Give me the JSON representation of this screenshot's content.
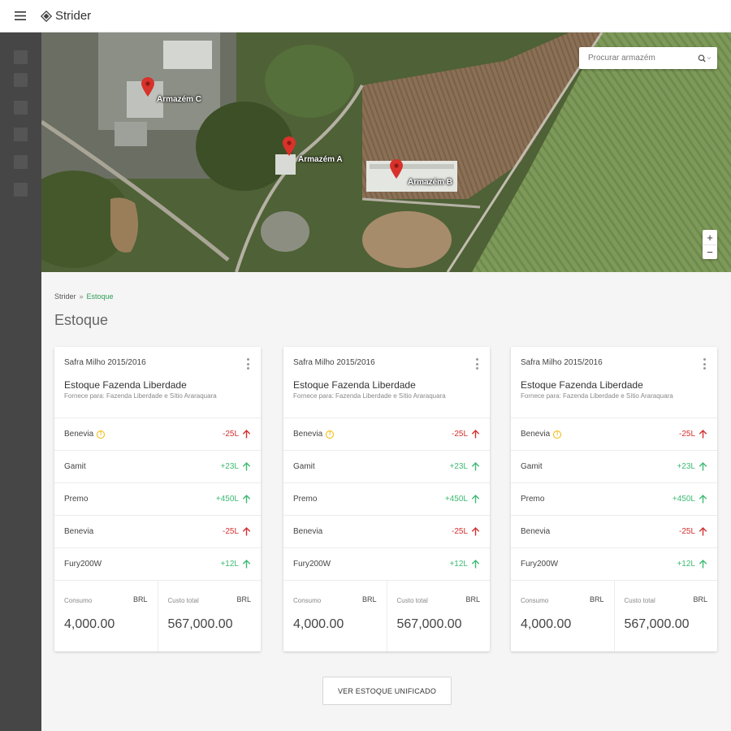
{
  "app": {
    "name": "Strider"
  },
  "sidebar": {
    "items": [
      "",
      "",
      "",
      "",
      "",
      ""
    ]
  },
  "map": {
    "search_placeholder": "Procurar armazém",
    "zoom_in": "+",
    "zoom_out": "−",
    "markers": [
      {
        "label": "Armazém C"
      },
      {
        "label": "Armazém A"
      },
      {
        "label": "Armazém B"
      }
    ]
  },
  "breadcrumb": {
    "root": "Strider",
    "separator": "»",
    "current": "Estoque"
  },
  "page_title": "Estoque",
  "cards": [
    {
      "season": "Safra Milho 2015/2016",
      "title": "Estoque Fazenda Liberdade",
      "subtitle": "Fornece para: Fazenda Liberdade e Sítio Araraquara",
      "rows": [
        {
          "name": "Benevia",
          "warning": true,
          "value": "-25L",
          "trend": "negative"
        },
        {
          "name": "Gamit",
          "warning": false,
          "value": "+23L",
          "trend": "positive"
        },
        {
          "name": "Premo",
          "warning": false,
          "value": "+450L",
          "trend": "positive"
        },
        {
          "name": "Benevia",
          "warning": false,
          "value": "-25L",
          "trend": "negative"
        },
        {
          "name": "Fury200W",
          "warning": false,
          "value": "+12L",
          "trend": "positive"
        }
      ],
      "consumo_label": "Consumo",
      "consumo_currency": "BRL",
      "consumo_value": "4,000.00",
      "custo_label": "Custo total",
      "custo_currency": "BRL",
      "custo_value": "567,000.00"
    },
    {
      "season": "Safra Milho 2015/2016",
      "title": "Estoque Fazenda Liberdade",
      "subtitle": "Fornece para: Fazenda Liberdade e Sítio Araraquara",
      "rows": [
        {
          "name": "Benevia",
          "warning": true,
          "value": "-25L",
          "trend": "negative"
        },
        {
          "name": "Gamit",
          "warning": false,
          "value": "+23L",
          "trend": "positive"
        },
        {
          "name": "Premo",
          "warning": false,
          "value": "+450L",
          "trend": "positive"
        },
        {
          "name": "Benevia",
          "warning": false,
          "value": "-25L",
          "trend": "negative"
        },
        {
          "name": "Fury200W",
          "warning": false,
          "value": "+12L",
          "trend": "positive"
        }
      ],
      "consumo_label": "Consumo",
      "consumo_currency": "BRL",
      "consumo_value": "4,000.00",
      "custo_label": "Custo total",
      "custo_currency": "BRL",
      "custo_value": "567,000.00"
    },
    {
      "season": "Safra Milho 2015/2016",
      "title": "Estoque Fazenda Liberdade",
      "subtitle": "Fornece para: Fazenda Liberdade e Sítio Araraquara",
      "rows": [
        {
          "name": "Benevia",
          "warning": true,
          "value": "-25L",
          "trend": "negative"
        },
        {
          "name": "Gamit",
          "warning": false,
          "value": "+23L",
          "trend": "positive"
        },
        {
          "name": "Premo",
          "warning": false,
          "value": "+450L",
          "trend": "positive"
        },
        {
          "name": "Benevia",
          "warning": false,
          "value": "-25L",
          "trend": "negative"
        },
        {
          "name": "Fury200W",
          "warning": false,
          "value": "+12L",
          "trend": "positive"
        }
      ],
      "consumo_label": "Consumo",
      "consumo_currency": "BRL",
      "consumo_value": "4,000.00",
      "custo_label": "Custo total",
      "custo_currency": "BRL",
      "custo_value": "567,000.00"
    }
  ],
  "unified_button": "VER ESTOQUE UNIFICADO",
  "colors": {
    "positive": "#3dba72",
    "negative": "#d32f2f",
    "accent": "#2e9e55",
    "warning": "#f2b600",
    "sidebar": "#464646"
  }
}
